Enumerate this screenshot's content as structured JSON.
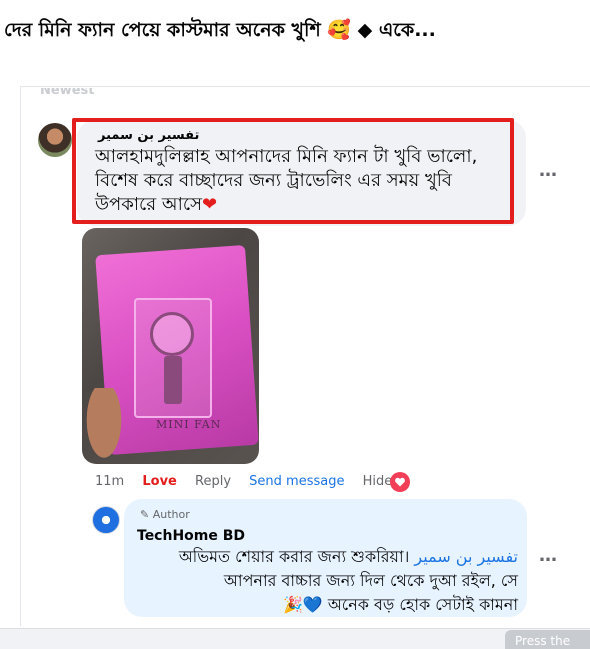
{
  "post": {
    "title": "দের মিনি ফ্যান পেয়ে কাস্টমার অনেক খুশি 🥰 ◆ একে..."
  },
  "sort": {
    "label": "Newest"
  },
  "comment": {
    "author": "تفسير بن سمير",
    "text": "আলহামদুলিল্লাহ আপনাদের মিনি ফ্যান টা খুবি ভালো, বিশেষ করে বাচ্ছাদের জন্য ট্রাভেলিং এর সময় খুবি উপকারে আসে",
    "heart": "❤",
    "more_icon": "…",
    "photo": {
      "label": "MINI FAN"
    },
    "actions": {
      "time": "11m",
      "love": "Love",
      "reply": "Reply",
      "send": "Send message",
      "hide": "Hide"
    },
    "reaction_icon": "heart-reaction"
  },
  "reply": {
    "badge": "Author",
    "author": "TechHome BD",
    "text_before": "অভিমত শেয়ার করার জন্য শুকরিয়া।",
    "mention": "تفسير بن سمير",
    "text_after": "আপনার বাচ্চার জন্য দিল থেকে দুআ রইল, সে",
    "emoji": "🎉💙",
    "text_end": "অনেক বড় হোক সেটাই কামনা",
    "more_icon": "…"
  },
  "footer": {
    "button_label": "Press the"
  },
  "colors": {
    "highlight": "#e41d1d",
    "link": "#1b74e4",
    "reply_bubble": "#e7f3ff",
    "comment_bubble": "#f0f2f5"
  }
}
